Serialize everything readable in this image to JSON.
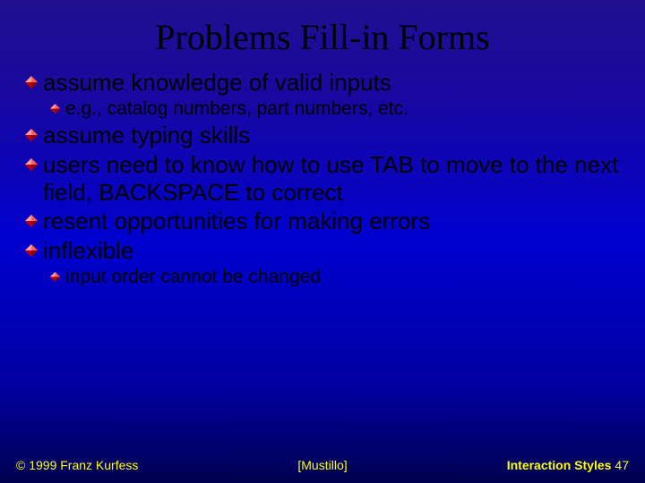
{
  "title": "Problems Fill-in Forms",
  "bullets": {
    "b1": "assume knowledge of valid inputs",
    "b1a": "e.g., catalog numbers, part numbers, etc.",
    "b2": "assume typing skills",
    "b3": "users need to know how to use TAB to move to the next field, BACKSPACE to correct",
    "b4": "resent opportunities for making errors",
    "b5": "inflexible",
    "b5a": "input order cannot be changed"
  },
  "footer": {
    "copyright": "© 1999 Franz Kurfess",
    "citation": "[Mustillo]",
    "section": "Interaction Styles",
    "page": "47"
  },
  "colors": {
    "bullet_fill": "#ff0000",
    "bullet_edge_light": "#ff9090",
    "bullet_edge_dark": "#800000"
  }
}
